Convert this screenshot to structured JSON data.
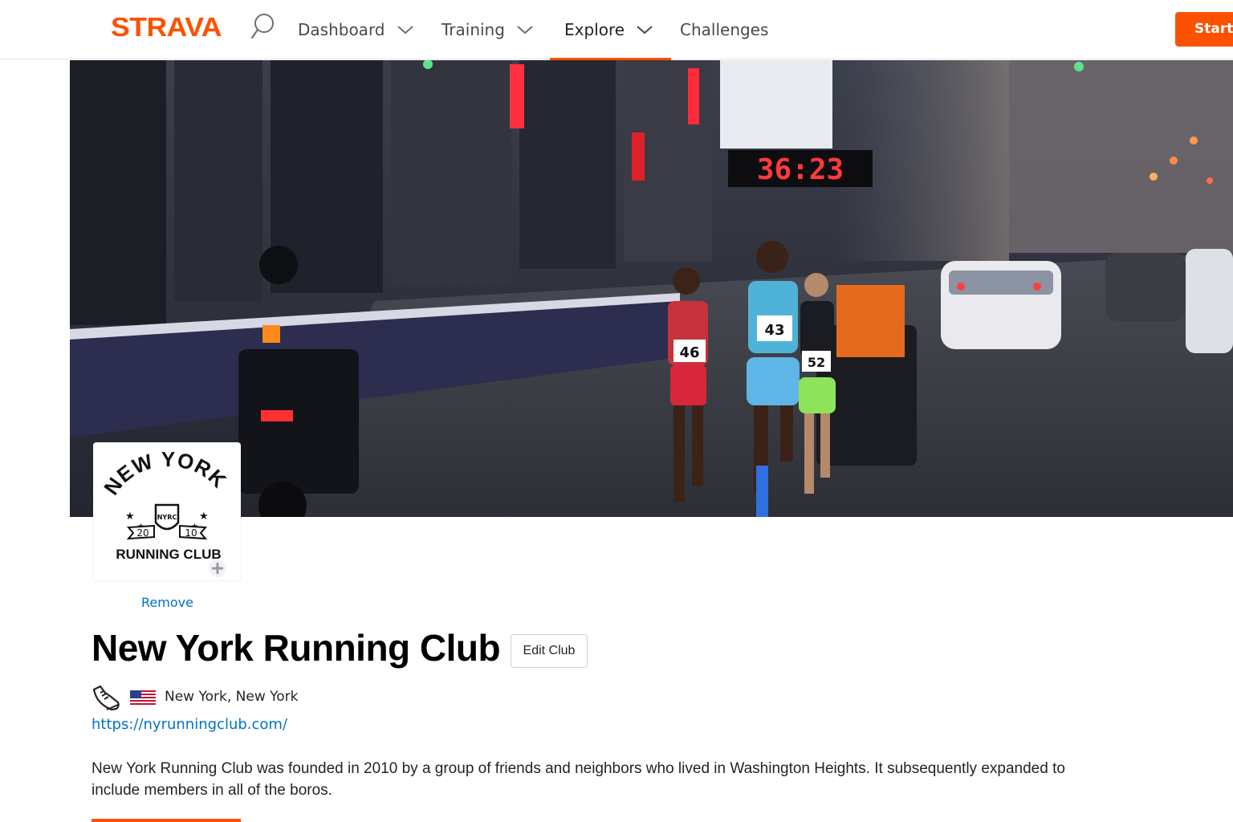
{
  "nav": {
    "logo": "STRAVA",
    "items": [
      {
        "label": "Dashboard"
      },
      {
        "label": "Training"
      },
      {
        "label": "Explore"
      },
      {
        "label": "Challenges"
      }
    ],
    "start_label": "Start T",
    "accent_color": "#fc5200"
  },
  "cover": {
    "clock": "36:23",
    "bibs": [
      "46",
      "43",
      "52"
    ],
    "icons": [
      "runner-photo"
    ]
  },
  "club": {
    "logo": {
      "line1": "NEW YORK",
      "line2": "RUNNING CLUB",
      "year_left": "20",
      "year_right": "10",
      "shield": "NYRC"
    },
    "remove_label": "Remove",
    "name": "New York Running Club",
    "edit_label": "Edit Club",
    "location": "New York, New York",
    "website": "https://nyrunningclub.com/",
    "description": "New York Running Club was founded in 2010 by a group of friends and neighbors who lived in Washington Heights. It subsequently expanded to include members in all of the boros.",
    "icons": [
      "shoe-icon",
      "us-flag-icon",
      "add-icon"
    ]
  }
}
